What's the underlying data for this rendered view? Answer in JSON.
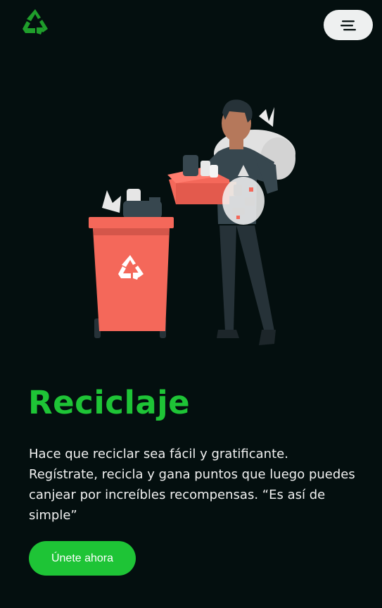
{
  "header": {
    "logo_icon": "recycle-icon",
    "menu_icon": "hamburger-menu-icon"
  },
  "hero": {
    "title": "Reciclaje",
    "description": "Hace que reciclar sea fácil y gratificante. Regístrate, recicla y gana puntos que luego puedes canjear por increíbles recompensas. “Es así de simple”",
    "cta_label": "Únete ahora",
    "illustration_icon": "person-recycling-illustration"
  },
  "colors": {
    "background": "#040f0f",
    "accent": "#1ec436",
    "text": "#f1f1f1",
    "bin": "#f4685a",
    "menu_button": "#eef0f0"
  }
}
